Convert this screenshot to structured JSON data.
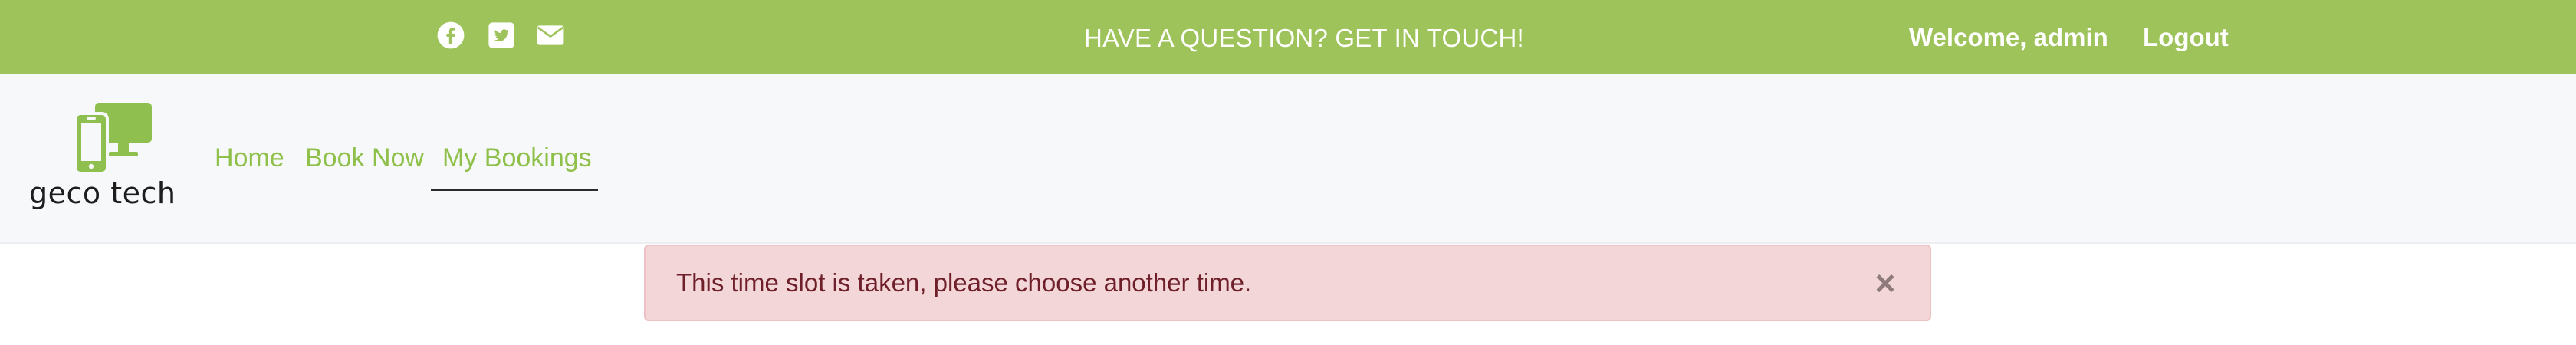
{
  "topbar": {
    "icons": [
      "facebook-icon",
      "twitter-icon",
      "email-icon"
    ],
    "center_text": "HAVE A QUESTION? GET IN TOUCH!",
    "welcome_text": "Welcome, admin",
    "logout_label": "Logout"
  },
  "brand": {
    "logo_text": "geco tech",
    "logo_icon": "devices-icon"
  },
  "nav": {
    "items": [
      {
        "label": "Home",
        "active": false
      },
      {
        "label": "Book Now",
        "active": false
      },
      {
        "label": "My Bookings",
        "active": true
      }
    ]
  },
  "alert": {
    "message": "This time slot is taken, please choose another time.",
    "close_label": "×"
  },
  "colors": {
    "topbar_bg": "#9dc35a",
    "nav_link": "#8fc04a",
    "alert_bg": "#f2d6d8",
    "alert_text": "#6e1f29"
  }
}
